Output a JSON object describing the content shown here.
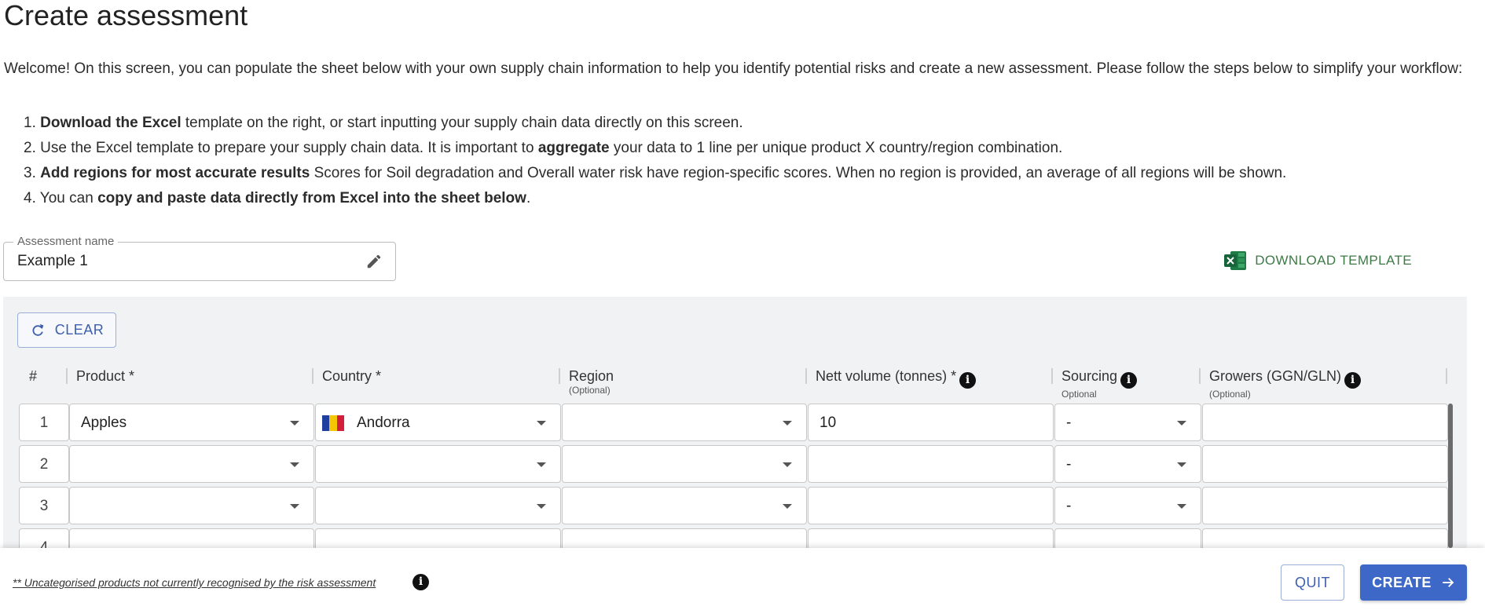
{
  "page": {
    "title": "Create assessment",
    "intro": "Welcome! On this screen, you can populate the sheet below with your own supply chain information to help you identify potential risks and create a new assessment. Please follow the steps below to simplify your workflow:",
    "steps": [
      {
        "num": "1.",
        "bold": "Download the Excel",
        "rest": " template on the right, or start inputting your supply chain data directly on this screen."
      },
      {
        "num": "2.",
        "pre": "Use the Excel template to prepare your supply chain data. It is important to ",
        "bold": "aggregate",
        "rest": " your data to 1 line per unique product X country/region combination."
      },
      {
        "num": "3.",
        "bold": "Add regions for most accurate results",
        "rest": " Scores for Soil degradation and Overall water risk have region-specific scores. When no region is provided, an average of all regions will be shown."
      },
      {
        "num": "4.",
        "pre": "You can ",
        "bold": "copy and paste data directly from Excel into the sheet below",
        "rest": "."
      }
    ]
  },
  "assessment_name": {
    "label": "Assessment name",
    "value": "Example 1"
  },
  "download_template": {
    "label": "DOWNLOAD TEMPLATE",
    "icon": "excel-icon",
    "color": "#3d7a45"
  },
  "sheet": {
    "clear_label": "CLEAR",
    "columns": [
      {
        "label": "#"
      },
      {
        "label": "Product *"
      },
      {
        "label": "Country *"
      },
      {
        "label": "Region",
        "sub": "(Optional)"
      },
      {
        "label": "Nett volume (tonnes) *",
        "info": "i"
      },
      {
        "label": "Sourcing",
        "sub": "Optional",
        "info": "i"
      },
      {
        "label": "Growers (GGN/GLN)",
        "sub": "(Optional)",
        "info": "i"
      }
    ],
    "rows": [
      {
        "num": "1",
        "product": "Apples",
        "country": "Andorra",
        "country_flag": "andorra-flag",
        "region": "",
        "volume": "10",
        "sourcing": "-",
        "growers": ""
      },
      {
        "num": "2",
        "product": "",
        "country": "",
        "region": "",
        "volume": "",
        "sourcing": "-",
        "growers": ""
      },
      {
        "num": "3",
        "product": "",
        "country": "",
        "region": "",
        "volume": "",
        "sourcing": "-",
        "growers": ""
      },
      {
        "num": "4",
        "product": "",
        "country": "",
        "region": "",
        "volume": "",
        "sourcing": "",
        "growers": ""
      }
    ]
  },
  "footer": {
    "footnote": "** Uncategorised products not currently recognised by the risk assessment",
    "info": "i",
    "quit_label": "QUIT",
    "create_label": "CREATE"
  },
  "colors": {
    "accent": "#3e68c8",
    "excel_green": "#3d7a45"
  }
}
